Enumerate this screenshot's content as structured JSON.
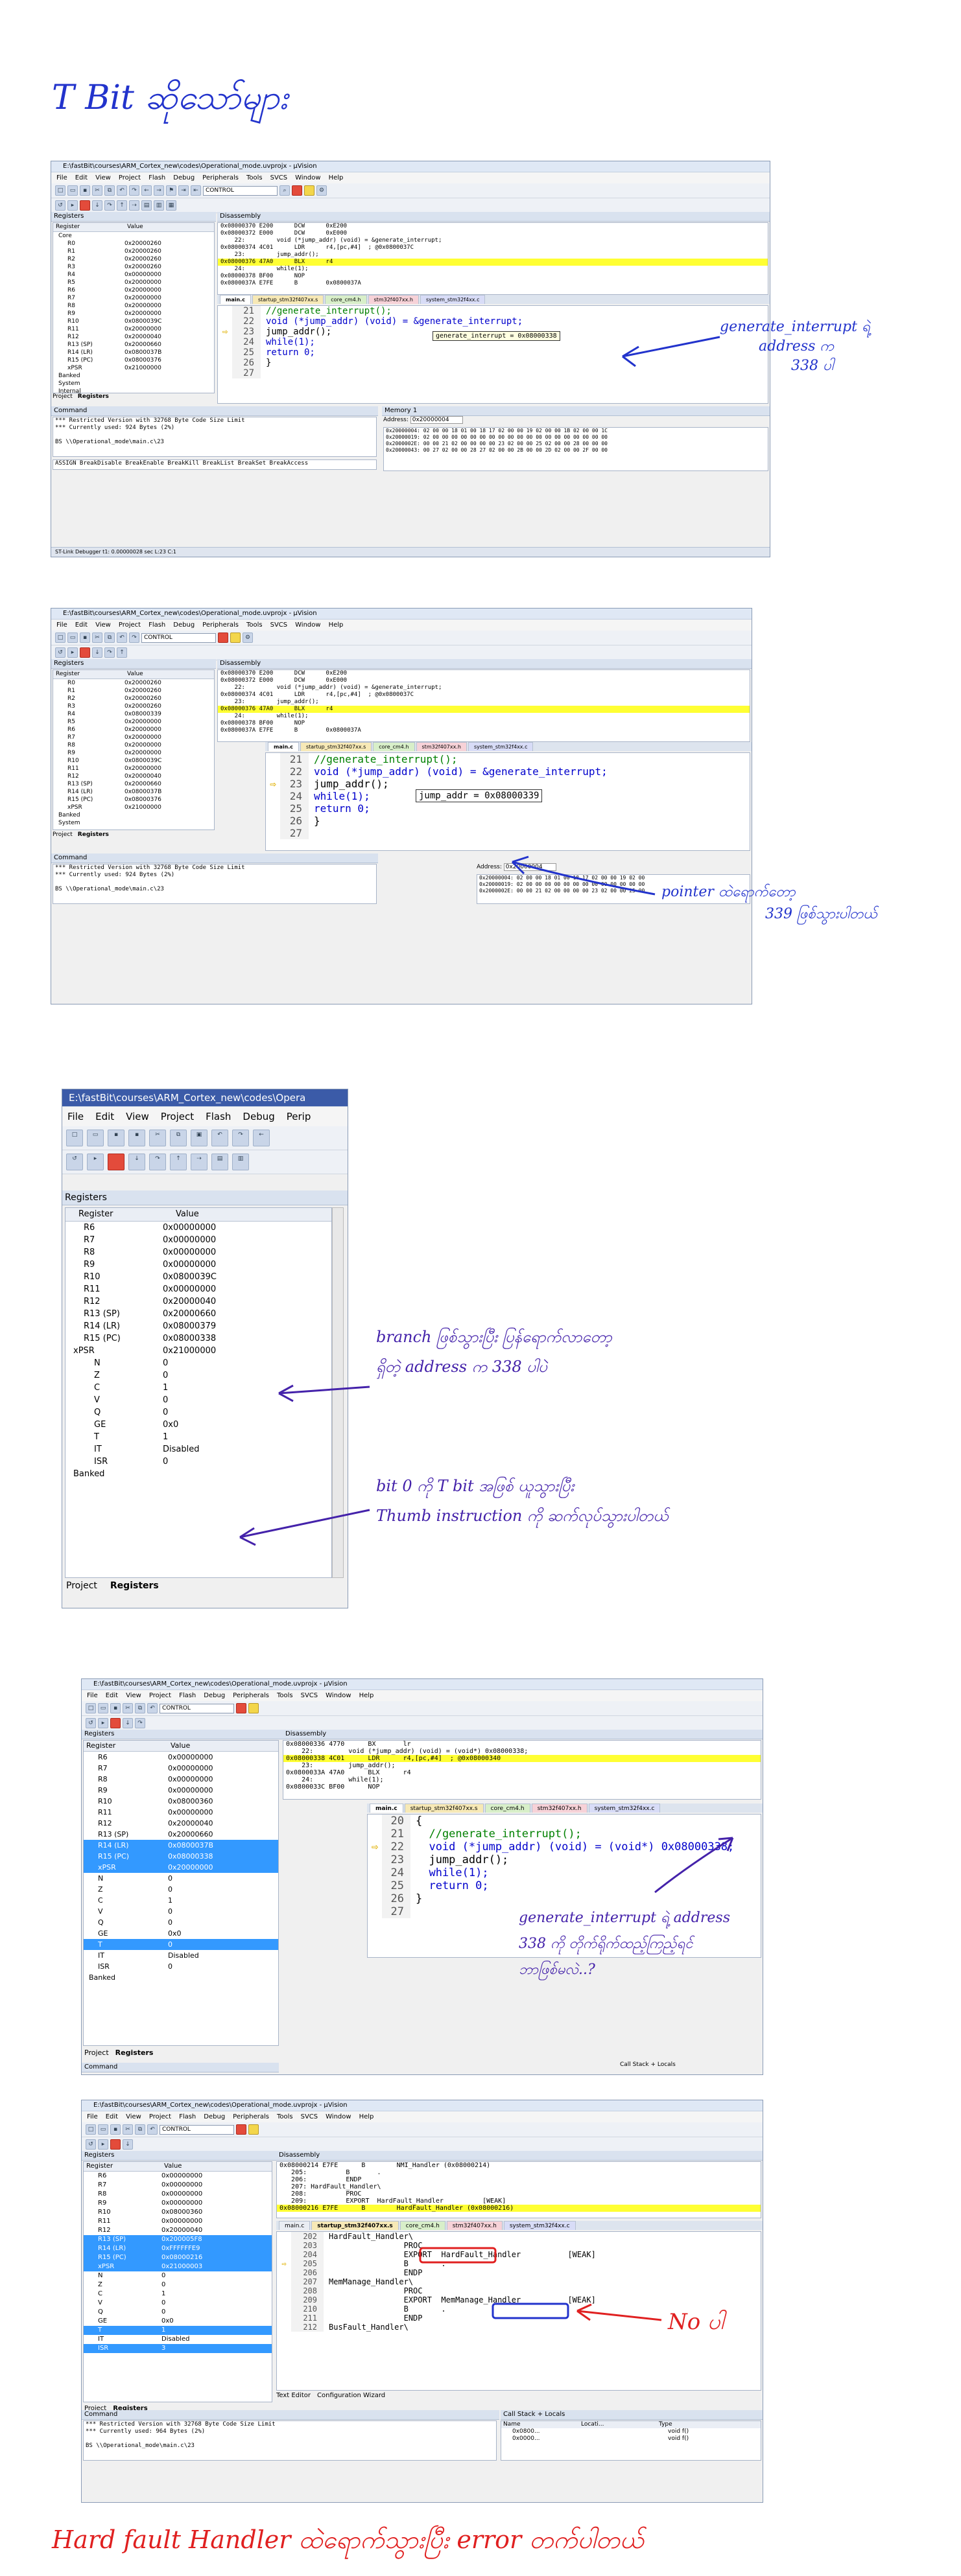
{
  "page_heading": "T Bit ဆိုသော်များ",
  "ide": {
    "title_path": "E:\\fastBit\\courses\\ARM_Cortex_new\\codes\\Operational_mode.uvprojx - µVision",
    "menu": [
      "File",
      "Edit",
      "View",
      "Project",
      "Flash",
      "Debug",
      "Peripherals",
      "Tools",
      "SVCS",
      "Window",
      "Help"
    ],
    "target_combo": "CONTROL",
    "registers_title": "Registers",
    "disassembly_title": "Disassembly",
    "command_title": "Command",
    "memory_title": "Memory 1",
    "address_label": "Address:",
    "address_value": "0x20000004",
    "col_register": "Register",
    "col_value": "Value",
    "tab_project": "Project",
    "tab_registers": "Registers",
    "file_tabs": [
      "main.c",
      "startup_stm32f407xx.s",
      "core_cm4.h",
      "stm32f407xx.h",
      "system_stm32f4xx.c"
    ]
  },
  "shot1": {
    "registers": [
      {
        "n": "Core",
        "v": ""
      },
      {
        "n": "R0",
        "v": "0x20000260"
      },
      {
        "n": "R1",
        "v": "0x20000260"
      },
      {
        "n": "R2",
        "v": "0x20000260"
      },
      {
        "n": "R3",
        "v": "0x20000260"
      },
      {
        "n": "R4",
        "v": "0x00000000"
      },
      {
        "n": "R5",
        "v": "0x20000000"
      },
      {
        "n": "R6",
        "v": "0x20000000"
      },
      {
        "n": "R7",
        "v": "0x20000000"
      },
      {
        "n": "R8",
        "v": "0x20000000"
      },
      {
        "n": "R9",
        "v": "0x20000000"
      },
      {
        "n": "R10",
        "v": "0x0800039C"
      },
      {
        "n": "R11",
        "v": "0x20000000"
      },
      {
        "n": "R12",
        "v": "0x20000040"
      },
      {
        "n": "R13 (SP)",
        "v": "0x20000660"
      },
      {
        "n": "R14 (LR)",
        "v": "0x0800037B"
      },
      {
        "n": "R15 (PC)",
        "v": "0x08000376"
      },
      {
        "n": "xPSR",
        "v": "0x21000000"
      },
      {
        "n": "Banked",
        "v": ""
      },
      {
        "n": "System",
        "v": ""
      },
      {
        "n": "Internal",
        "v": ""
      }
    ],
    "disassembly": [
      "0x08000370 E200      DCW      0xE200",
      "0x08000372 E000      DCW      0xE000",
      "    22:         void (*jump_addr) (void) = &generate_interrupt;",
      "0x08000374 4C01      LDR      r4,[pc,#4]  ; @0x0800037C",
      "    23:         jump_addr();",
      "0x08000376 47A0      BLX      r4",
      "    24:         while(1);",
      "0x08000378 BF00      NOP",
      "0x0800037A E7FE      B        0x0800037A"
    ],
    "code": [
      {
        "no": "21",
        "text": "//generate_interrupt();"
      },
      {
        "no": "22",
        "text": "void (*jump_addr) (void) = &generate_interrupt;"
      },
      {
        "no": "23",
        "text": "jump_addr();"
      },
      {
        "no": "24",
        "text": "while(1);"
      },
      {
        "no": "25",
        "text": "return 0;"
      },
      {
        "no": "26",
        "text": "}"
      },
      {
        "no": "27",
        "text": ""
      }
    ],
    "tooltip": "generate_interrupt = 0x08000338",
    "command": [
      "*** Restricted Version with 32768 Byte Code Size Limit",
      "*** Currently used: 924 Bytes (2%)",
      "",
      "BS \\\\Operational_mode\\main.c\\23"
    ],
    "command_hint": "ASSIGN BreakDisable BreakEnable BreakKill BreakList BreakSet BreakAccess",
    "memory": [
      "0x20000004: 02 00 00 18 01 00 18 17 02 00 00 19 02 00 00 1B 02 00 00 1C",
      "0x20000019: 02 00 00 00 00 00 00 00 00 00 00 00 00 00 00 00 00 00 00 00",
      "0x2000002E: 00 00 21 02 00 00 00 00 23 02 00 00 25 02 00 00 28 00 00 00",
      "0x20000043: 00 27 02 00 00 28 27 02 00 00 2B 00 00 2D 02 00 00 2F 00 00"
    ],
    "status": "ST-Link Debugger        t1: 0.00000028 sec        L:23 C:1",
    "note_title": "generate_interrupt ရဲ့",
    "note_line2": "address က",
    "note_line3": "338 ပါ"
  },
  "shot2": {
    "registers": [
      {
        "n": "R0",
        "v": "0x20000260"
      },
      {
        "n": "R1",
        "v": "0x20000260"
      },
      {
        "n": "R2",
        "v": "0x20000260"
      },
      {
        "n": "R3",
        "v": "0x20000260"
      },
      {
        "n": "R4",
        "v": "0x08000339"
      },
      {
        "n": "R5",
        "v": "0x20000000"
      },
      {
        "n": "R6",
        "v": "0x20000000"
      },
      {
        "n": "R7",
        "v": "0x20000000"
      },
      {
        "n": "R8",
        "v": "0x20000000"
      },
      {
        "n": "R9",
        "v": "0x20000000"
      },
      {
        "n": "R10",
        "v": "0x0800039C"
      },
      {
        "n": "R11",
        "v": "0x20000000"
      },
      {
        "n": "R12",
        "v": "0x20000040"
      },
      {
        "n": "R13 (SP)",
        "v": "0x20000660"
      },
      {
        "n": "R14 (LR)",
        "v": "0x0800037B"
      },
      {
        "n": "R15 (PC)",
        "v": "0x08000376"
      },
      {
        "n": "xPSR",
        "v": "0x21000000"
      },
      {
        "n": "Banked",
        "v": ""
      },
      {
        "n": "System",
        "v": ""
      }
    ],
    "disassembly": [
      "0x08000370 E200      DCW      0xE200",
      "0x08000372 E000      DCW      0xE000",
      "    22:         void (*jump_addr) (void) = &generate_interrupt;",
      "0x08000374 4C01      LDR      r4,[pc,#4]  ; @0x0800037C",
      "    23:         jump_addr();",
      "0x08000376 47A0      BLX      r4",
      "    24:         while(1);",
      "0x08000378 BF00      NOP",
      "0x0800037A E7FE      B        0x0800037A"
    ],
    "code": [
      {
        "no": "21",
        "text": "//generate_interrupt();"
      },
      {
        "no": "22",
        "text": "void (*jump_addr) (void) = &generate_interrupt;"
      },
      {
        "no": "23",
        "text": "jump_addr();"
      },
      {
        "no": "24",
        "text": "while(1);"
      },
      {
        "no": "25",
        "text": "return 0;"
      },
      {
        "no": "26",
        "text": "}"
      },
      {
        "no": "27",
        "text": ""
      }
    ],
    "tooltip": "jump_addr = 0x08000339",
    "command": [
      "*** Restricted Version with 32768 Byte Code Size Limit",
      "*** Currently used: 924 Bytes (2%)",
      "",
      "BS \\\\Operational_mode\\main.c\\23"
    ],
    "memory": [
      "0x20000004: 02 00 00 18 01 00 18 17 02 00 00 19 02 00",
      "0x20000019: 02 00 00 00 00 00 00 00 00 00 00 00 00 00",
      "0x2000002E: 00 00 21 02 00 00 00 00 23 02 00 00 25 00"
    ],
    "note_line1": "pointer ထဲရောက်တော့",
    "note_line2": "339 ဖြစ်သွားပါတယ်"
  },
  "shot3": {
    "title": "E:\\fastBit\\courses\\ARM_Cortex_new\\codes\\Opera",
    "menu": [
      "File",
      "Edit",
      "View",
      "Project",
      "Flash",
      "Debug",
      "Perip"
    ],
    "registers": [
      {
        "n": "R6",
        "v": "0x00000000",
        "sel": false,
        "i": 1
      },
      {
        "n": "R7",
        "v": "0x00000000",
        "sel": false,
        "i": 1
      },
      {
        "n": "R8",
        "v": "0x00000000",
        "sel": false,
        "i": 1
      },
      {
        "n": "R9",
        "v": "0x00000000",
        "sel": false,
        "i": 1
      },
      {
        "n": "R10",
        "v": "0x0800039C",
        "sel": false,
        "i": 1
      },
      {
        "n": "R11",
        "v": "0x00000000",
        "sel": false,
        "i": 1
      },
      {
        "n": "R12",
        "v": "0x20000040",
        "sel": false,
        "i": 1
      },
      {
        "n": "R13 (SP)",
        "v": "0x20000660",
        "sel": false,
        "i": 1
      },
      {
        "n": "R14 (LR)",
        "v": "0x08000379",
        "sel": false,
        "i": 1
      },
      {
        "n": "R15 (PC)",
        "v": "0x08000338",
        "sel": false,
        "i": 1
      },
      {
        "n": "xPSR",
        "v": "0x21000000",
        "sel": false,
        "i": 0
      },
      {
        "n": "N",
        "v": "0",
        "sel": false,
        "i": 2
      },
      {
        "n": "Z",
        "v": "0",
        "sel": false,
        "i": 2
      },
      {
        "n": "C",
        "v": "1",
        "sel": false,
        "i": 2
      },
      {
        "n": "V",
        "v": "0",
        "sel": false,
        "i": 2
      },
      {
        "n": "Q",
        "v": "0",
        "sel": false,
        "i": 2
      },
      {
        "n": "GE",
        "v": "0x0",
        "sel": false,
        "i": 2
      },
      {
        "n": "T",
        "v": "1",
        "sel": false,
        "i": 2
      },
      {
        "n": "IT",
        "v": "Disabled",
        "sel": false,
        "i": 2
      },
      {
        "n": "ISR",
        "v": "0",
        "sel": false,
        "i": 2
      },
      {
        "n": "Banked",
        "v": "",
        "sel": false,
        "i": 0
      }
    ],
    "note1_line1": "branch ဖြစ်သွားပြီး ပြန်ရောက်လာတော့",
    "note1_line2": "ရှိတဲ့ address က 338 ပါပဲ",
    "note2_line1": "bit 0 ကို T bit အဖြစ် ယူသွားပြီး",
    "note2_line2": "Thumb instruction ကို ဆက်လုပ်သွားပါတယ်"
  },
  "shot4": {
    "registers": [
      {
        "n": "R6",
        "v": "0x00000000",
        "sel": false
      },
      {
        "n": "R7",
        "v": "0x00000000",
        "sel": false
      },
      {
        "n": "R8",
        "v": "0x00000000",
        "sel": false
      },
      {
        "n": "R9",
        "v": "0x00000000",
        "sel": false
      },
      {
        "n": "R10",
        "v": "0x08000360",
        "sel": false
      },
      {
        "n": "R11",
        "v": "0x00000000",
        "sel": false
      },
      {
        "n": "R12",
        "v": "0x20000040",
        "sel": false
      },
      {
        "n": "R13 (SP)",
        "v": "0x20000660",
        "sel": false
      },
      {
        "n": "R14 (LR)",
        "v": "0x0800037B",
        "sel": true
      },
      {
        "n": "R15 (PC)",
        "v": "0x08000338",
        "sel": true
      },
      {
        "n": "xPSR",
        "v": "0x20000000",
        "sel": true
      },
      {
        "n": "N",
        "v": "0",
        "sel": false
      },
      {
        "n": "Z",
        "v": "0",
        "sel": false
      },
      {
        "n": "C",
        "v": "1",
        "sel": false
      },
      {
        "n": "V",
        "v": "0",
        "sel": false
      },
      {
        "n": "Q",
        "v": "0",
        "sel": false
      },
      {
        "n": "GE",
        "v": "0x0",
        "sel": false
      },
      {
        "n": "T",
        "v": "0",
        "sel": true
      },
      {
        "n": "IT",
        "v": "Disabled",
        "sel": false
      },
      {
        "n": "ISR",
        "v": "0",
        "sel": false
      },
      {
        "n": "Banked",
        "v": "",
        "sel": false
      }
    ],
    "disassembly": [
      "0x08000336 4770      BX       lr",
      "    22:         void (*jump_addr) (void) = (void*) 0x08000338;",
      "0x08000338 4C01      LDR      r4,[pc,#4]  ; @0x08000340",
      "    23:         jump_addr();",
      "0x0800033A 47A0      BLX      r4",
      "    24:         while(1);",
      "0x0800033C BF00      NOP"
    ],
    "code": [
      {
        "no": "20",
        "text": "{"
      },
      {
        "no": "21",
        "text": "  //generate_interrupt();"
      },
      {
        "no": "22",
        "text": "  void (*jump_addr) (void) = (void*) 0x08000338;"
      },
      {
        "no": "23",
        "text": "  jump_addr();"
      },
      {
        "no": "24",
        "text": "  while(1);"
      },
      {
        "no": "25",
        "text": "  return 0;"
      },
      {
        "no": "26",
        "text": "}"
      },
      {
        "no": "27",
        "text": ""
      }
    ],
    "callstack": "Call Stack + Locals",
    "note_line1": "generate_interrupt ရဲ့ address",
    "note_line2": "338 ကို တိုက်ရိုက်ထည့်ကြည့်ရင်",
    "note_line3": "ဘာဖြစ်မလဲ..?"
  },
  "shot5": {
    "registers": [
      {
        "n": "R6",
        "v": "0x00000000",
        "sel": false
      },
      {
        "n": "R7",
        "v": "0x00000000",
        "sel": false
      },
      {
        "n": "R8",
        "v": "0x00000000",
        "sel": false
      },
      {
        "n": "R9",
        "v": "0x00000000",
        "sel": false
      },
      {
        "n": "R10",
        "v": "0x08000360",
        "sel": false
      },
      {
        "n": "R11",
        "v": "0x00000000",
        "sel": false
      },
      {
        "n": "R12",
        "v": "0x20000040",
        "sel": false
      },
      {
        "n": "R13 (SP)",
        "v": "0x200005F8",
        "sel": true
      },
      {
        "n": "R14 (LR)",
        "v": "0xFFFFFFE9",
        "sel": true
      },
      {
        "n": "R15 (PC)",
        "v": "0x08000216",
        "sel": true
      },
      {
        "n": "xPSR",
        "v": "0x21000003",
        "sel": true
      },
      {
        "n": "N",
        "v": "0",
        "sel": false
      },
      {
        "n": "Z",
        "v": "0",
        "sel": false
      },
      {
        "n": "C",
        "v": "1",
        "sel": false
      },
      {
        "n": "V",
        "v": "0",
        "sel": false
      },
      {
        "n": "Q",
        "v": "0",
        "sel": false
      },
      {
        "n": "GE",
        "v": "0x0",
        "sel": false
      },
      {
        "n": "T",
        "v": "1",
        "sel": true
      },
      {
        "n": "IT",
        "v": "Disabled",
        "sel": false
      },
      {
        "n": "ISR",
        "v": "3",
        "sel": true
      }
    ],
    "disassembly": [
      "0x08000214 E7FE      B        NMI_Handler (0x08000214)",
      "   205:          B       .",
      "   206:          ENDP",
      "   207: HardFault_Handler\\",
      "   208:          PROC",
      "   209:          EXPORT  HardFault_Handler          [WEAK]",
      "0x08000216 E7FE      B        HardFault_Handler (0x08000216)"
    ],
    "code": [
      {
        "no": "202",
        "text": "HardFault_Handler\\"
      },
      {
        "no": "203",
        "text": "                PROC"
      },
      {
        "no": "204",
        "text": "                EXPORT  HardFault_Handler          [WEAK]"
      },
      {
        "no": "205",
        "text": "                B       ."
      },
      {
        "no": "206",
        "text": "                ENDP"
      },
      {
        "no": "207",
        "text": "MemManage_Handler\\"
      },
      {
        "no": "208",
        "text": "                PROC"
      },
      {
        "no": "209",
        "text": "                EXPORT  MemManage_Handler          [WEAK]"
      },
      {
        "no": "210",
        "text": "                B       ."
      },
      {
        "no": "211",
        "text": "                ENDP"
      },
      {
        "no": "212",
        "text": "BusFault_Handler\\"
      }
    ],
    "editor_tabs": [
      "Text Editor",
      "Configuration Wizard"
    ],
    "command": [
      "*** Restricted Version with 32768 Byte Code Size Limit",
      "*** Currently used: 964 Bytes (2%)",
      "",
      "BS \\\\Operational_mode\\main.c\\23"
    ],
    "callstack_title": "Call Stack + Locals",
    "callstack_cols": [
      "Name",
      "Locati...",
      "Type"
    ],
    "callstack_rows": [
      {
        "name": "0x0800...",
        "type": "void f()"
      },
      {
        "name": "0x0000...",
        "type": "void f()"
      }
    ],
    "note": "No ပါ",
    "footer": "Hard fault Handler ထဲရောက်သွားပြီး error တက်ပါတယ်"
  }
}
